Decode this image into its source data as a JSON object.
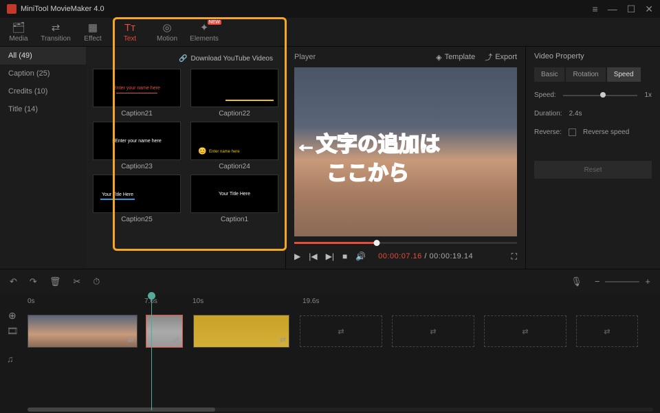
{
  "app": {
    "title": "MiniTool MovieMaker 4.0"
  },
  "tabs": [
    {
      "label": "Media",
      "icon": "🗂"
    },
    {
      "label": "Transition",
      "icon": "↔"
    },
    {
      "label": "Effect",
      "icon": "▦"
    },
    {
      "label": "Text",
      "icon": "Tᴛ"
    },
    {
      "label": "Motion",
      "icon": "◎"
    },
    {
      "label": "Elements",
      "icon": "✦",
      "badge": "NEW"
    }
  ],
  "categories": [
    {
      "label": "All (49)",
      "active": true
    },
    {
      "label": "Caption (25)"
    },
    {
      "label": "Credits (10)"
    },
    {
      "label": "Title (14)"
    }
  ],
  "download_link": "Download YouTube Videos",
  "thumbs": [
    {
      "label": "Caption21"
    },
    {
      "label": "Caption22"
    },
    {
      "label": "Caption23"
    },
    {
      "label": "Caption24"
    },
    {
      "label": "Caption25"
    },
    {
      "label": "Caption1"
    }
  ],
  "player": {
    "title": "Player",
    "template": "Template",
    "export": "Export",
    "current": "00:00:07.16",
    "duration": "00:00:19.14"
  },
  "props": {
    "title": "Video Property",
    "tabs": {
      "basic": "Basic",
      "rotation": "Rotation",
      "speed": "Speed"
    },
    "speed_label": "Speed:",
    "speed_value": "1x",
    "duration_label": "Duration:",
    "duration_value": "2.4s",
    "reverse_label": "Reverse:",
    "reverse_check": "Reverse speed",
    "reset": "Reset"
  },
  "ruler": {
    "m0": "0s",
    "m1": "7.6s",
    "m2": "10s",
    "m3": "19.6s"
  },
  "annotation": {
    "line1": "←文字の追加は",
    "line2": "ここから"
  }
}
